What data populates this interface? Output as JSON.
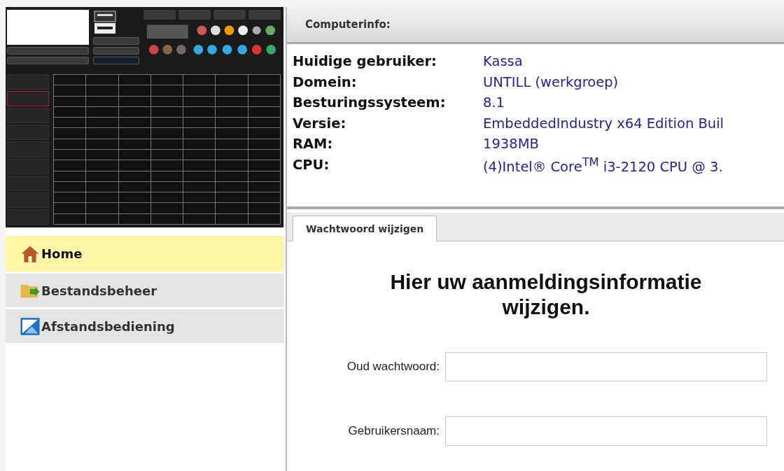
{
  "nav": [
    {
      "label": "Home",
      "kind": "home",
      "selected": true
    },
    {
      "label": "Bestandsbeheer",
      "kind": "folder",
      "selected": false
    },
    {
      "label": "Afstandsbediening",
      "kind": "remote",
      "selected": false
    }
  ],
  "computer_info": {
    "title": "Computerinfo:",
    "rows": [
      {
        "label": "Huidige gebruiker:",
        "value": "Kassa"
      },
      {
        "label": "Domein:",
        "value": "UNTILL (werkgroep)"
      },
      {
        "label": "Besturingssysteem:",
        "value": "8.1"
      },
      {
        "label": "Versie:",
        "value": "EmbeddedIndustry x64 Edition Buil"
      },
      {
        "label": "RAM:",
        "value": "1938MB"
      },
      {
        "label": "CPU:",
        "value": "(4)Intel® Core$^{TM}$ i3-2120 CPU @ 3."
      }
    ]
  },
  "tabs": [
    {
      "label": "Wachtwoord wijzigen",
      "selected": true
    }
  ],
  "form": {
    "heading": "Hier uw aanmeldingsinformatie wijzigen.",
    "fields": [
      {
        "label": "Oud wachtwoord:"
      },
      {
        "label": "Gebruikersnaam:"
      }
    ]
  }
}
